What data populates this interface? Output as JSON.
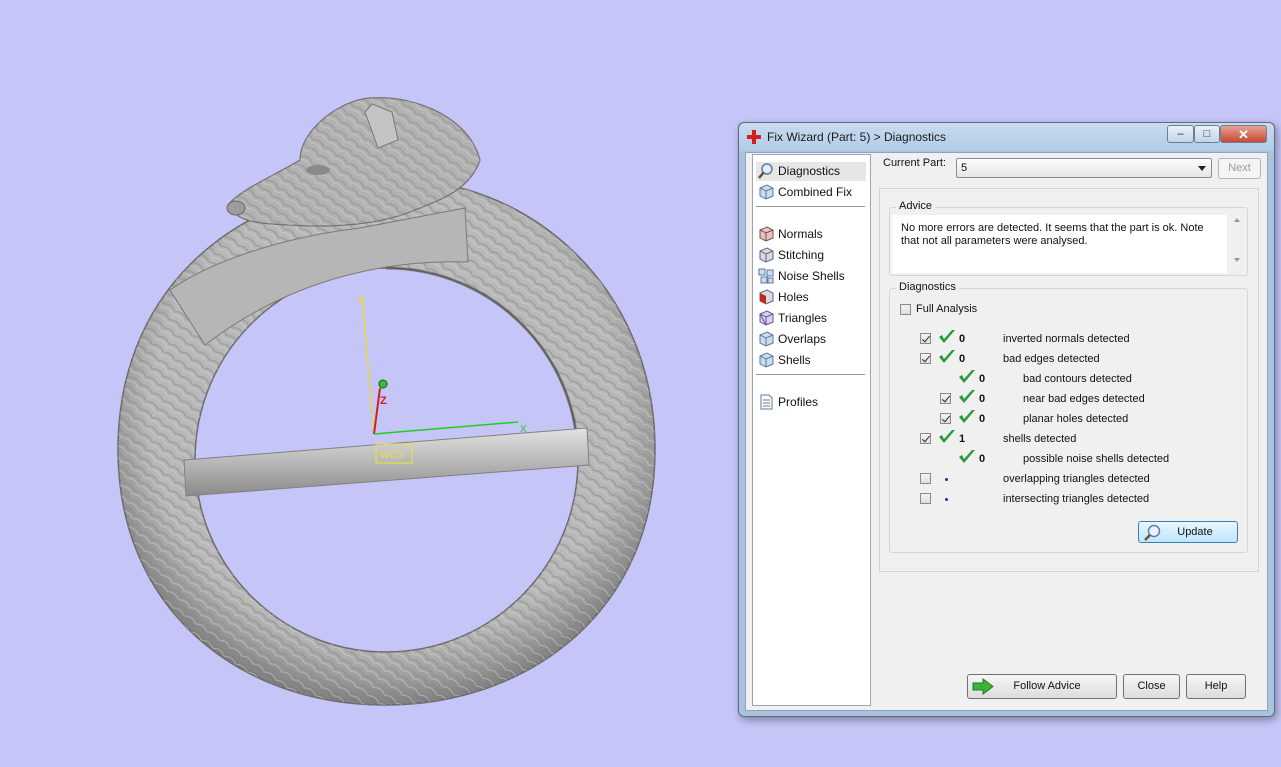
{
  "viewport": {
    "background": "#c5c5f7",
    "axis_labels": {
      "y": "Y",
      "z": "Z",
      "x": "X"
    },
    "wcs_label": "WCS",
    "colors": {
      "y_axis": "#e8d840",
      "z_axis": "#cc2020",
      "x_axis": "#22cc22",
      "model": "#a8a8a8"
    }
  },
  "window": {
    "title": "Fix Wizard (Part: 5) > Diagnostics",
    "title_icon": "red-cross-icon",
    "controls": {
      "minimize": "‒",
      "maximize": "□",
      "close": "✕"
    }
  },
  "nav": {
    "group1": [
      {
        "label": "Diagnostics",
        "icon": "magnifier-icon",
        "selected": true
      },
      {
        "label": "Combined Fix",
        "icon": "cube-icon"
      }
    ],
    "group2": [
      {
        "label": "Normals",
        "icon": "normals-cube-icon"
      },
      {
        "label": "Stitching",
        "icon": "stitching-cube-icon"
      },
      {
        "label": "Noise Shells",
        "icon": "noise-shells-icon"
      },
      {
        "label": "Holes",
        "icon": "holes-cube-icon"
      },
      {
        "label": "Triangles",
        "icon": "triangles-cube-icon"
      },
      {
        "label": "Overlaps",
        "icon": "overlaps-cube-icon"
      },
      {
        "label": "Shells",
        "icon": "shells-cube-icon"
      }
    ],
    "group3": [
      {
        "label": "Profiles",
        "icon": "document-icon"
      }
    ]
  },
  "current_part": {
    "label": "Current Part:",
    "value": "5",
    "next_label": "Next"
  },
  "advice": {
    "title": "Advice",
    "line1": "No more errors are detected. It seems that the part is ok. Note",
    "line2": "that not all parameters were analysed."
  },
  "diagnostics": {
    "title": "Diagnostics",
    "full_analysis_label": "Full Analysis",
    "full_analysis_checked": false,
    "rows": [
      {
        "checkbox": true,
        "checked": true,
        "status": "ok",
        "count": "0",
        "label": "inverted normals detected",
        "indent": 0
      },
      {
        "checkbox": true,
        "checked": true,
        "status": "ok",
        "count": "0",
        "label": "bad edges detected",
        "indent": 0
      },
      {
        "checkbox": false,
        "checked": false,
        "status": "ok",
        "count": "0",
        "label": "bad contours detected",
        "indent": 1
      },
      {
        "checkbox": true,
        "checked": true,
        "status": "ok",
        "count": "0",
        "label": "near bad edges detected",
        "indent": 1
      },
      {
        "checkbox": true,
        "checked": true,
        "status": "ok",
        "count": "0",
        "label": "planar holes detected",
        "indent": 1
      },
      {
        "checkbox": true,
        "checked": true,
        "status": "ok",
        "count": "1",
        "label": "shells detected",
        "indent": 0
      },
      {
        "checkbox": false,
        "checked": false,
        "status": "ok",
        "count": "0",
        "label": "possible noise shells detected",
        "indent": 1
      },
      {
        "checkbox": true,
        "checked": false,
        "status": "pending",
        "count": "",
        "label": "overlapping triangles detected",
        "indent": 0
      },
      {
        "checkbox": true,
        "checked": false,
        "status": "pending",
        "count": "",
        "label": "intersecting triangles detected",
        "indent": 0
      }
    ],
    "update_label": "Update"
  },
  "buttons": {
    "follow_advice": "Follow Advice",
    "close": "Close",
    "help": "Help"
  }
}
